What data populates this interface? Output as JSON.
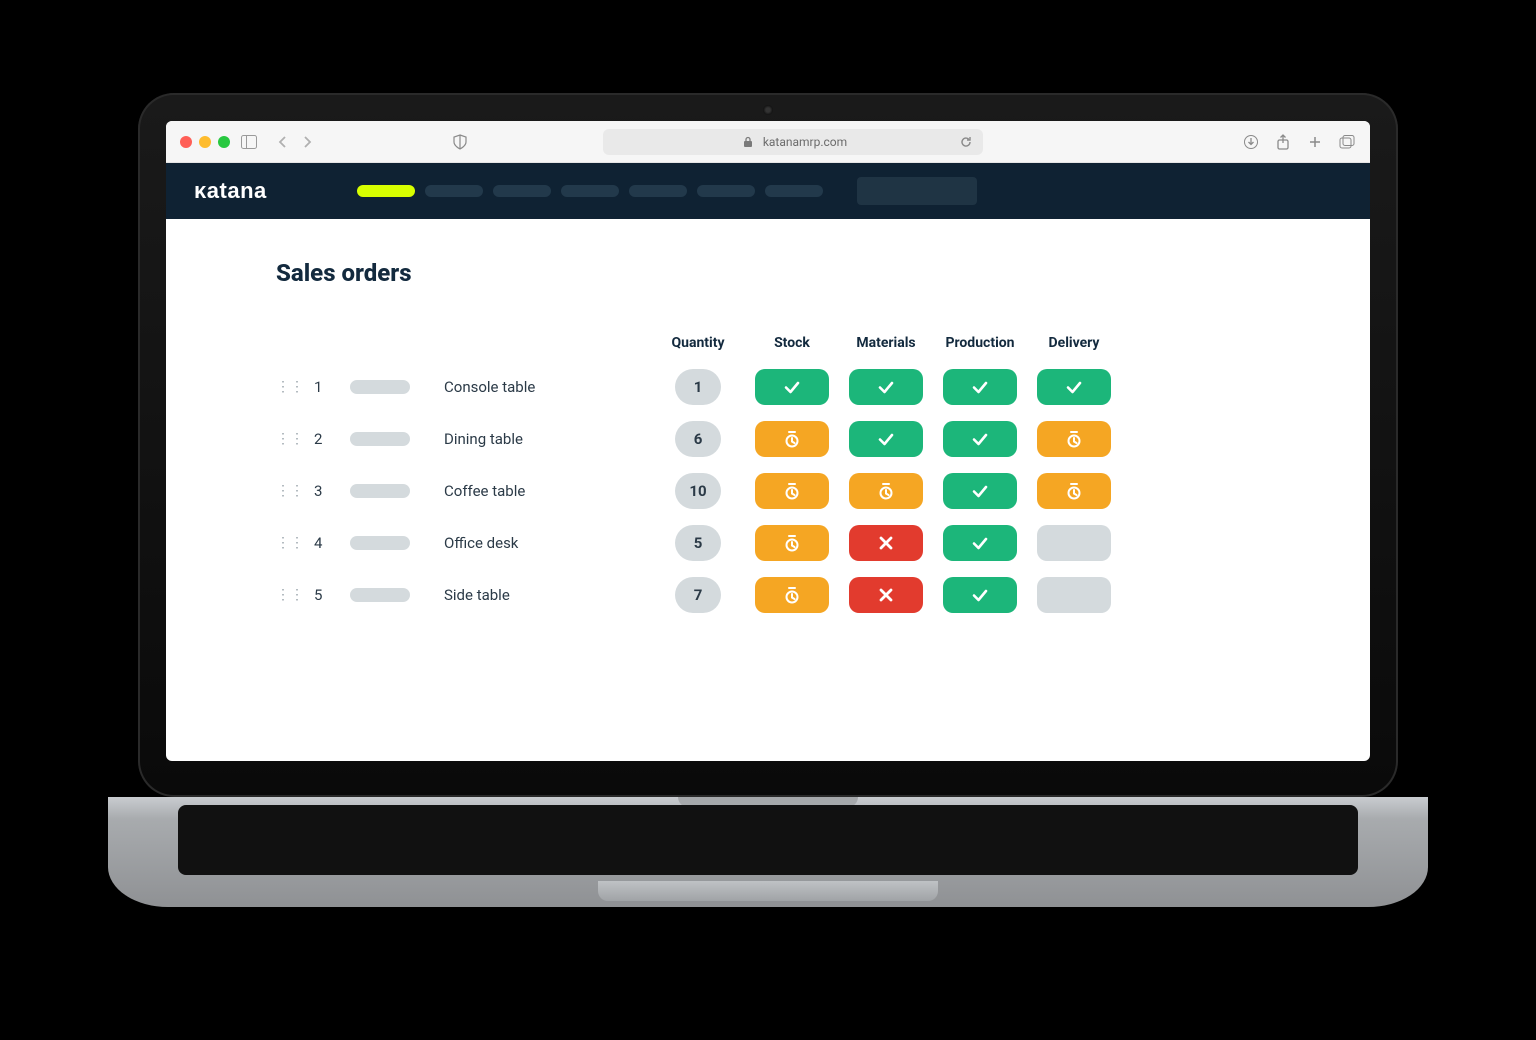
{
  "browser": {
    "domain": "katanamrp.com"
  },
  "app": {
    "logo": "ᴋatana"
  },
  "page": {
    "title": "Sales orders",
    "columns": [
      "Quantity",
      "Stock",
      "Materials",
      "Production",
      "Delivery"
    ]
  },
  "status_colors": {
    "green": "#1cb67a",
    "orange": "#f5a623",
    "red": "#e23b2e",
    "empty": "#d4dadd"
  },
  "rows": [
    {
      "num": "1",
      "name": "Console table",
      "qty": "1",
      "stock": "green",
      "materials": "green",
      "production": "green",
      "delivery": "green"
    },
    {
      "num": "2",
      "name": "Dining table",
      "qty": "6",
      "stock": "orange",
      "materials": "green",
      "production": "green",
      "delivery": "orange"
    },
    {
      "num": "3",
      "name": "Coffee table",
      "qty": "10",
      "stock": "orange",
      "materials": "orange",
      "production": "green",
      "delivery": "orange"
    },
    {
      "num": "4",
      "name": "Office desk",
      "qty": "5",
      "stock": "orange",
      "materials": "red",
      "production": "green",
      "delivery": "empty"
    },
    {
      "num": "5",
      "name": "Side table",
      "qty": "7",
      "stock": "orange",
      "materials": "red",
      "production": "green",
      "delivery": "empty"
    }
  ]
}
